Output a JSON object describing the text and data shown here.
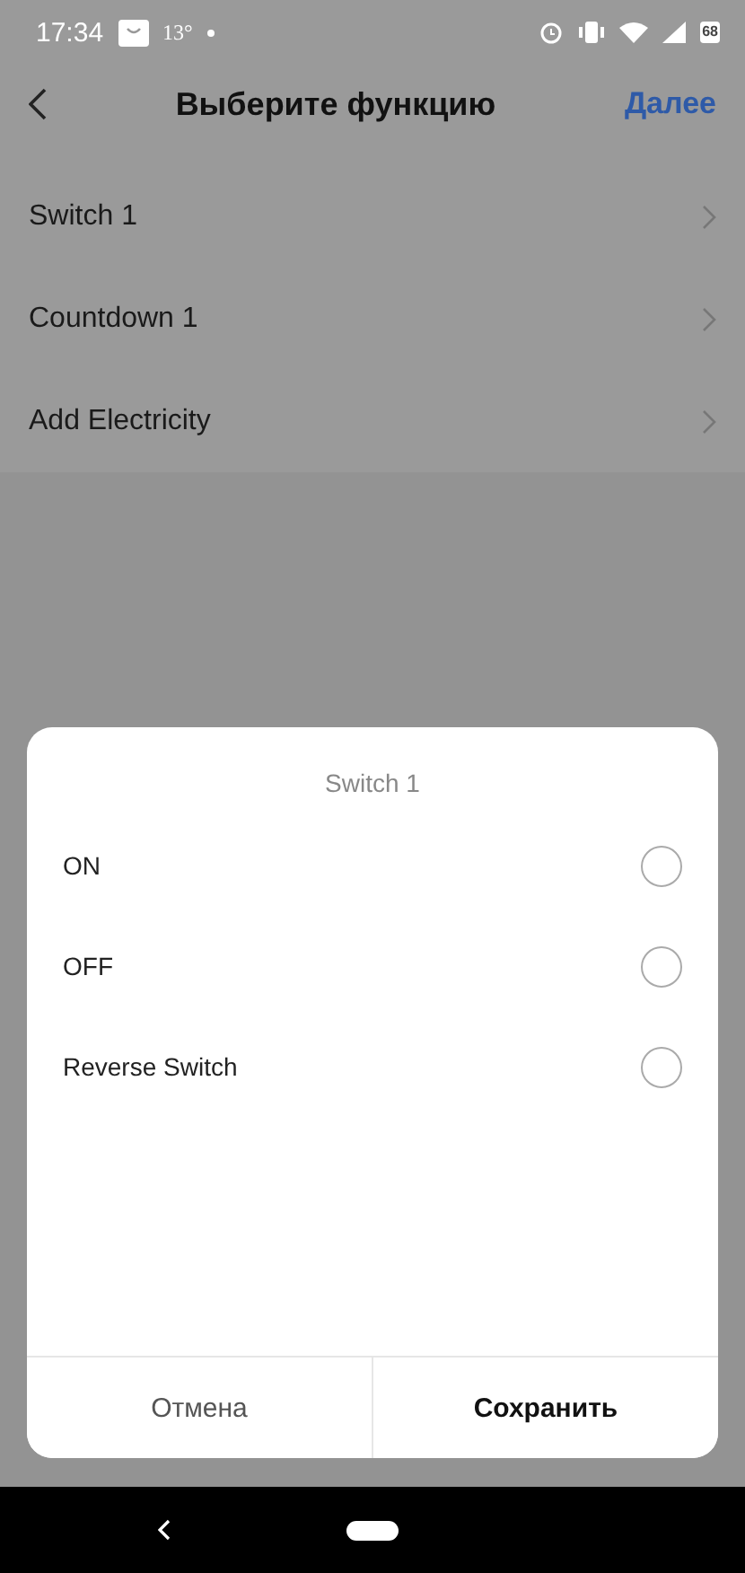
{
  "status_bar": {
    "time": "17:34",
    "temperature": "13°",
    "battery": "68"
  },
  "header": {
    "title": "Выберите функцию",
    "action": "Далее"
  },
  "functions": [
    {
      "label": "Switch 1"
    },
    {
      "label": "Countdown 1"
    },
    {
      "label": "Add Electricity"
    }
  ],
  "dialog": {
    "title": "Switch 1",
    "options": [
      {
        "label": "ON",
        "selected": false
      },
      {
        "label": "OFF",
        "selected": false
      },
      {
        "label": "Reverse Switch",
        "selected": false
      }
    ],
    "buttons": [
      {
        "label": "Отмена",
        "kind": "secondary"
      },
      {
        "label": "Сохранить",
        "kind": "primary"
      }
    ]
  }
}
